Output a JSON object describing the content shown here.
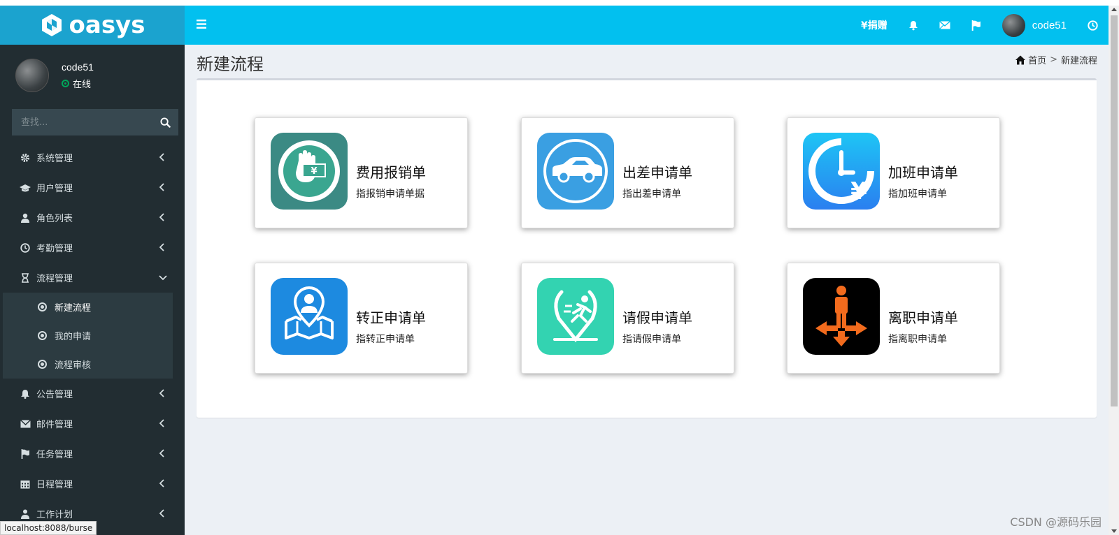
{
  "logo": {
    "text": "oasys"
  },
  "user": {
    "name": "code51",
    "status": "在线"
  },
  "search": {
    "placeholder": "查找..."
  },
  "sidebar": {
    "items": [
      {
        "label": "系统管理",
        "icon": "gear-icon"
      },
      {
        "label": "用户管理",
        "icon": "graduation-cap-icon"
      },
      {
        "label": "角色列表",
        "icon": "user-icon"
      },
      {
        "label": "考勤管理",
        "icon": "clock-icon"
      },
      {
        "label": "流程管理",
        "icon": "hourglass-icon"
      },
      {
        "label": "公告管理",
        "icon": "bell-icon"
      },
      {
        "label": "邮件管理",
        "icon": "envelope-icon"
      },
      {
        "label": "任务管理",
        "icon": "flag-icon"
      },
      {
        "label": "日程管理",
        "icon": "calendar-icon"
      },
      {
        "label": "工作计划",
        "icon": "user-tie-icon"
      }
    ],
    "submenu": [
      {
        "label": "新建流程"
      },
      {
        "label": "我的申请"
      },
      {
        "label": "流程审核"
      }
    ]
  },
  "header": {
    "donate": "¥捐赠",
    "username": "code51"
  },
  "content": {
    "title": "新建流程",
    "breadcrumb": {
      "home": "首页",
      "sep": ">",
      "current": "新建流程"
    }
  },
  "cards": [
    {
      "title": "费用报销单",
      "subtitle": "指报销申请单据",
      "icon": "expense-icon"
    },
    {
      "title": "出差申请单",
      "subtitle": "指出差申请单",
      "icon": "car-icon"
    },
    {
      "title": "加班申请单",
      "subtitle": "指加班申请单",
      "icon": "overtime-clock-icon"
    },
    {
      "title": "转正申请单",
      "subtitle": "指转正申请单",
      "icon": "regularize-icon"
    },
    {
      "title": "请假申请单",
      "subtitle": "指请假申请单",
      "icon": "leave-runner-icon"
    },
    {
      "title": "离职申请单",
      "subtitle": "指离职申请单",
      "icon": "resign-person-icon"
    }
  ],
  "status_bar": {
    "url": "localhost:8088/burse"
  },
  "watermark": "CSDN @源码乐园",
  "colors": {
    "topbar": "#02c0ef",
    "logo_bg": "#1ba3cf",
    "sidebar": "#222d32",
    "online": "#00a65a"
  }
}
